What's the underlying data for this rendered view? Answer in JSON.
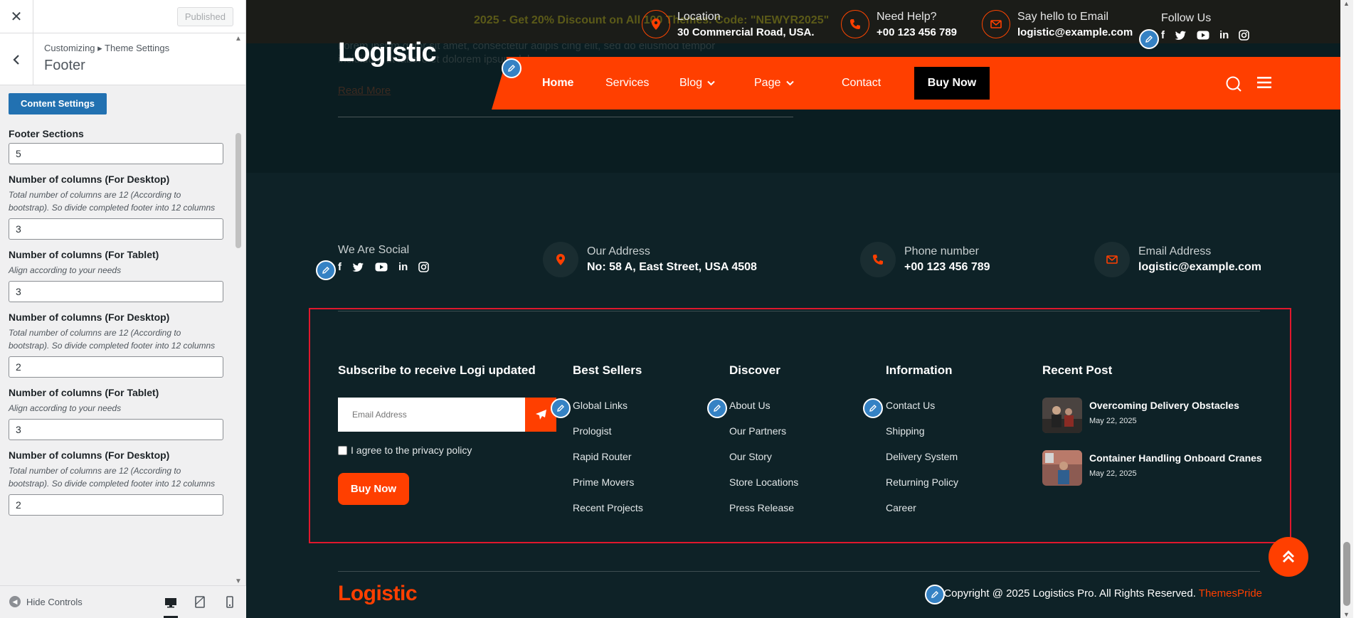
{
  "customizer": {
    "published_label": "Published",
    "breadcrumb": "Customizing ▸ Theme Settings",
    "section_title": "Footer",
    "content_settings_button": "Content Settings",
    "fields": [
      {
        "label": "Footer Sections",
        "desc": "",
        "value": "5"
      },
      {
        "label": "Number of columns (For Desktop)",
        "desc": "Total number of columns are 12 (According to bootstrap). So divide completed footer into 12 columns",
        "value": "3"
      },
      {
        "label": "Number of columns (For Tablet)",
        "desc": "Align according to your needs",
        "value": "3"
      },
      {
        "label": "Number of columns (For Desktop)",
        "desc": "Total number of columns are 12 (According to bootstrap). So divide completed footer into 12 columns",
        "value": "2"
      },
      {
        "label": "Number of columns (For Tablet)",
        "desc": "Align according to your needs",
        "value": "3"
      },
      {
        "label": "Number of columns (For Desktop)",
        "desc": "Total number of columns are 12 (According to bootstrap). So divide completed footer into 12 columns",
        "value": "2"
      }
    ],
    "hide_controls_label": "Hide Controls"
  },
  "topbar": {
    "promo": "2025 - Get 20% Discount on All 100 Themes. Code: \"NEWYR2025\"",
    "location_label": "Location",
    "location_value": "30 Commercial Road, USA.",
    "help_label": "Need Help?",
    "help_value": "+00 123 456 789",
    "email_label": "Say hello to Email",
    "email_value": "logistic@example.com",
    "follow_label": "Follow Us"
  },
  "brand": {
    "logo": "Logistic",
    "accent_color": "#ff3f00",
    "bg_color": "#0e2227"
  },
  "hero": {
    "ghost_text": "Lorem ipsum dolor sit amet, consectetur adipis cing elit, sed do eiusmod tempor incididunt ut labore et dolorem ipsum dolor.",
    "read_more": "Read More"
  },
  "nav": {
    "home": "Home",
    "services": "Services",
    "blog": "Blog",
    "page": "Page",
    "contact": "Contact",
    "buy_now": "Buy Now"
  },
  "contact_strip": {
    "social_label": "We Are Social",
    "address_label": "Our Address",
    "address_value": "No: 58 A, East Street, USA 4508",
    "phone_label": "Phone number",
    "phone_value": "+00 123 456 789",
    "email_label": "Email Address",
    "email_value": "logistic@example.com"
  },
  "footer": {
    "subscribe_title": "Subscribe to receive Logi updated",
    "email_placeholder": "Email Address",
    "agree_text": "I agree to the privacy policy",
    "buy_now": "Buy Now",
    "best_sellers_title": "Best Sellers",
    "best_sellers": [
      "Global Links",
      "Prologist",
      "Rapid Router",
      "Prime Movers",
      "Recent Projects"
    ],
    "discover_title": "Discover",
    "discover": [
      "About Us",
      "Our Partners",
      "Our Story",
      "Store Locations",
      "Press Release"
    ],
    "information_title": "Information",
    "information": [
      "Contact Us",
      "Shipping",
      "Delivery System",
      "Returning Policy",
      "Career"
    ],
    "recent_title": "Recent Post",
    "posts": [
      {
        "title": "Overcoming Delivery Obstacles",
        "date": "May 22, 2025"
      },
      {
        "title": "Container Handling Onboard Cranes",
        "date": "May 22, 2025"
      }
    ],
    "logo": "Logistic",
    "copyright": "Copyright @ 2025 Logistics Pro. All Rights Reserved.",
    "copyright_brand": "ThemesPride"
  },
  "icons": {
    "close": "close-icon",
    "back": "chevron-left-icon",
    "edit": "pencil-icon",
    "location": "location-pin-icon",
    "phone": "phone-icon",
    "email": "envelope-icon",
    "send": "paper-plane-icon",
    "back_to_top": "double-chevron-up-icon"
  }
}
